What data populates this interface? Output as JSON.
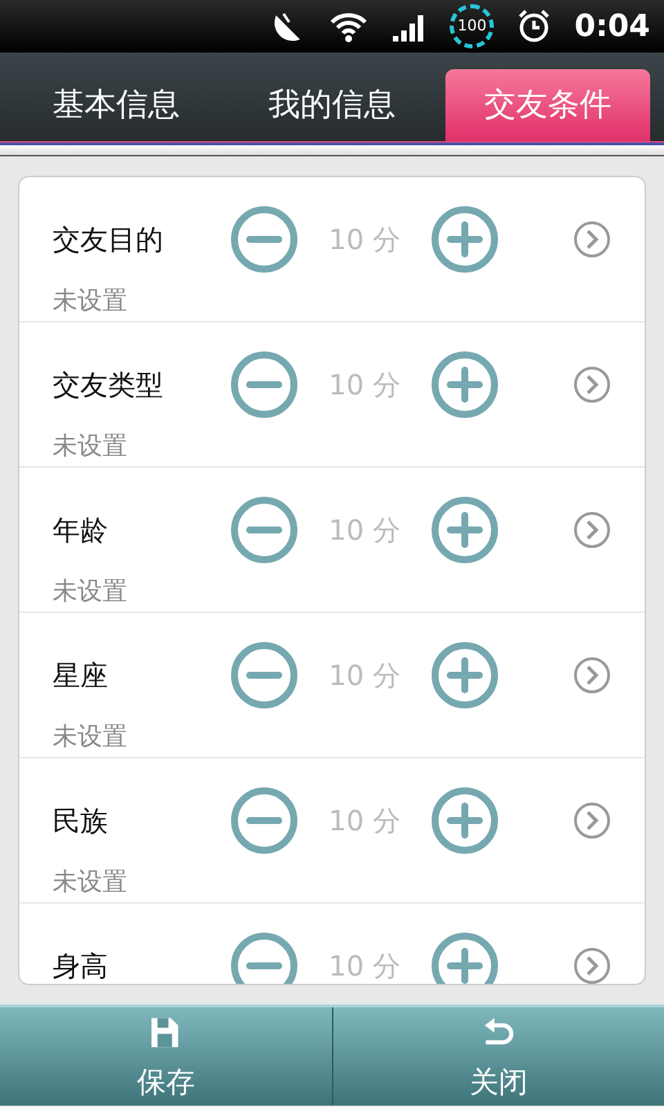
{
  "status_bar": {
    "battery": "100",
    "time": "0:04"
  },
  "tabs": [
    {
      "label": "基本信息",
      "selected": false
    },
    {
      "label": "我的信息",
      "selected": false
    },
    {
      "label": "交友条件",
      "selected": true
    }
  ],
  "conditions": [
    {
      "label": "交友目的",
      "score": "10 分",
      "status": "未设置"
    },
    {
      "label": "交友类型",
      "score": "10 分",
      "status": "未设置"
    },
    {
      "label": "年龄",
      "score": "10 分",
      "status": "未设置"
    },
    {
      "label": "星座",
      "score": "10 分",
      "status": "未设置"
    },
    {
      "label": "民族",
      "score": "10 分",
      "status": "未设置"
    },
    {
      "label": "身高",
      "score": "10 分"
    }
  ],
  "buttons": [
    {
      "kind": "save",
      "label": "保存"
    },
    {
      "kind": "close",
      "label": "关闭"
    }
  ]
}
